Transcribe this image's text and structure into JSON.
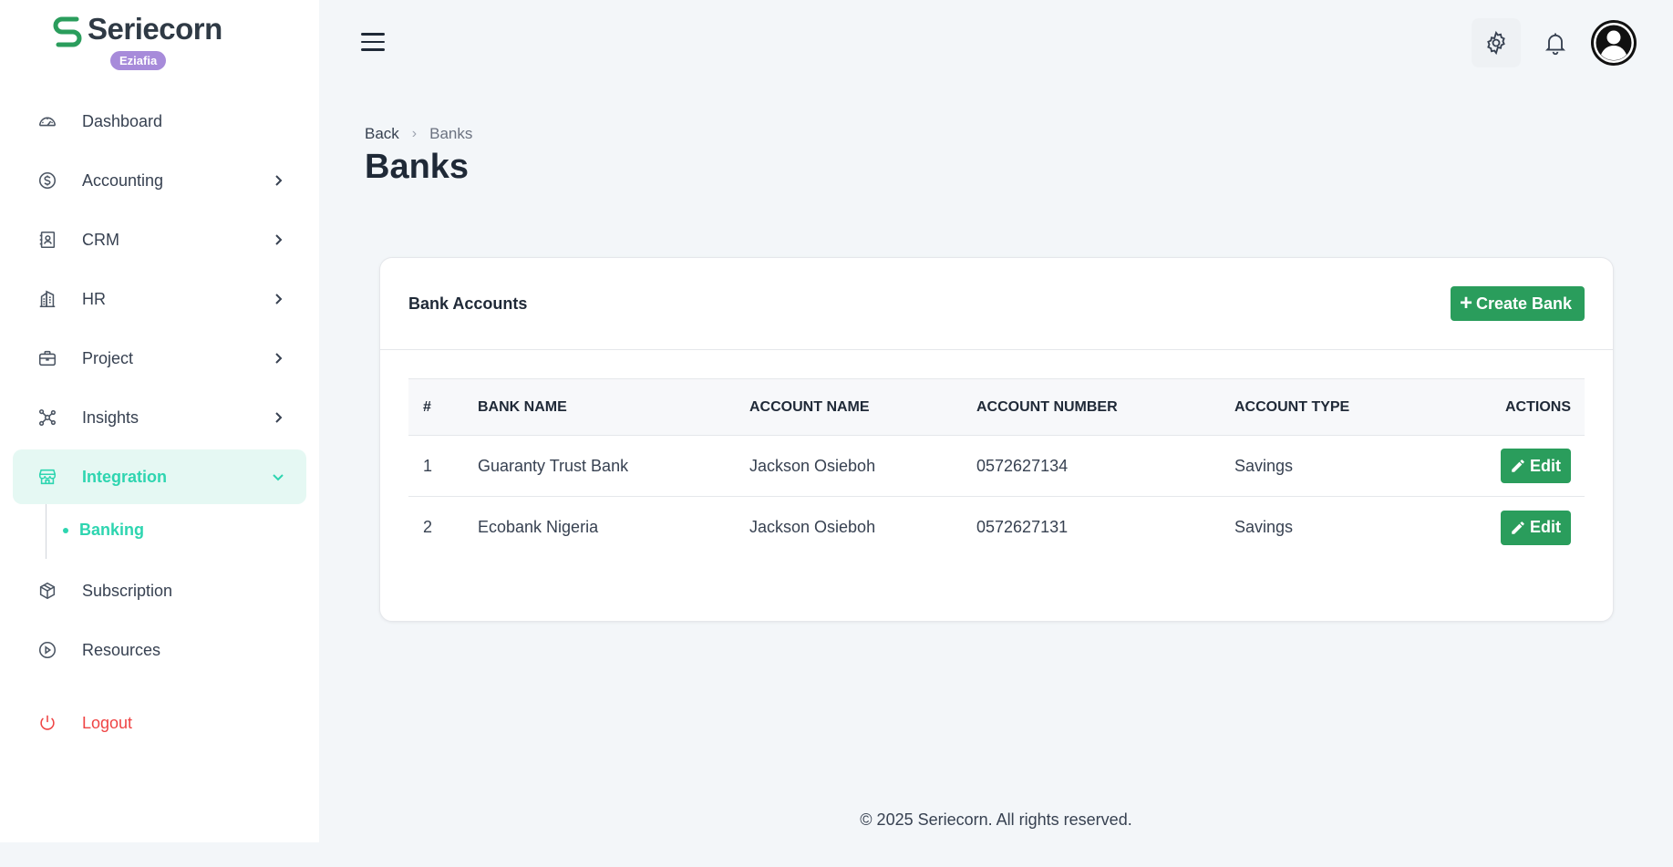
{
  "brand": {
    "name": "Seriecorn",
    "org_badge": "Eziafia"
  },
  "sidebar": {
    "items": [
      {
        "label": "Dashboard",
        "icon": "gauge-icon",
        "has_chevron": false
      },
      {
        "label": "Accounting",
        "icon": "dollar-circle-icon",
        "has_chevron": true
      },
      {
        "label": "CRM",
        "icon": "contact-book-icon",
        "has_chevron": true
      },
      {
        "label": "HR",
        "icon": "building-icon",
        "has_chevron": true
      },
      {
        "label": "Project",
        "icon": "briefcase-icon",
        "has_chevron": true
      },
      {
        "label": "Insights",
        "icon": "network-icon",
        "has_chevron": true
      },
      {
        "label": "Integration",
        "icon": "store-icon",
        "has_chevron": true,
        "active": true,
        "expanded": true,
        "children": [
          {
            "label": "Banking",
            "active": true
          }
        ]
      },
      {
        "label": "Subscription",
        "icon": "package-icon",
        "has_chevron": false
      },
      {
        "label": "Resources",
        "icon": "play-circle-icon",
        "has_chevron": false
      }
    ],
    "logout_label": "Logout"
  },
  "topbar": {
    "menu_icon": "hamburger-icon",
    "settings_icon": "gear-icon",
    "notifications_icon": "bell-icon",
    "avatar_icon": "user-avatar-icon"
  },
  "breadcrumb": {
    "back": "Back",
    "current": "Banks"
  },
  "page": {
    "title": "Banks"
  },
  "card": {
    "title": "Bank Accounts",
    "create_label": "Create Bank",
    "columns": [
      "#",
      "BANK NAME",
      "ACCOUNT NAME",
      "ACCOUNT NUMBER",
      "ACCOUNT TYPE",
      "ACTIONS"
    ],
    "rows": [
      {
        "num": "1",
        "bank_name": "Guaranty Trust Bank",
        "account_name": "Jackson Osieboh",
        "account_number": "0572627134",
        "account_type": "Savings",
        "action": "Edit"
      },
      {
        "num": "2",
        "bank_name": "Ecobank Nigeria",
        "account_name": "Jackson Osieboh",
        "account_number": "0572627131",
        "account_type": "Savings",
        "action": "Edit"
      }
    ]
  },
  "footer": {
    "text": "© 2025 Seriecorn. All rights reserved."
  },
  "colors": {
    "accent": "#2ed5b0",
    "primary_button": "#2a9d5c",
    "badge": "#a78bda",
    "logout": "#ef4444"
  }
}
